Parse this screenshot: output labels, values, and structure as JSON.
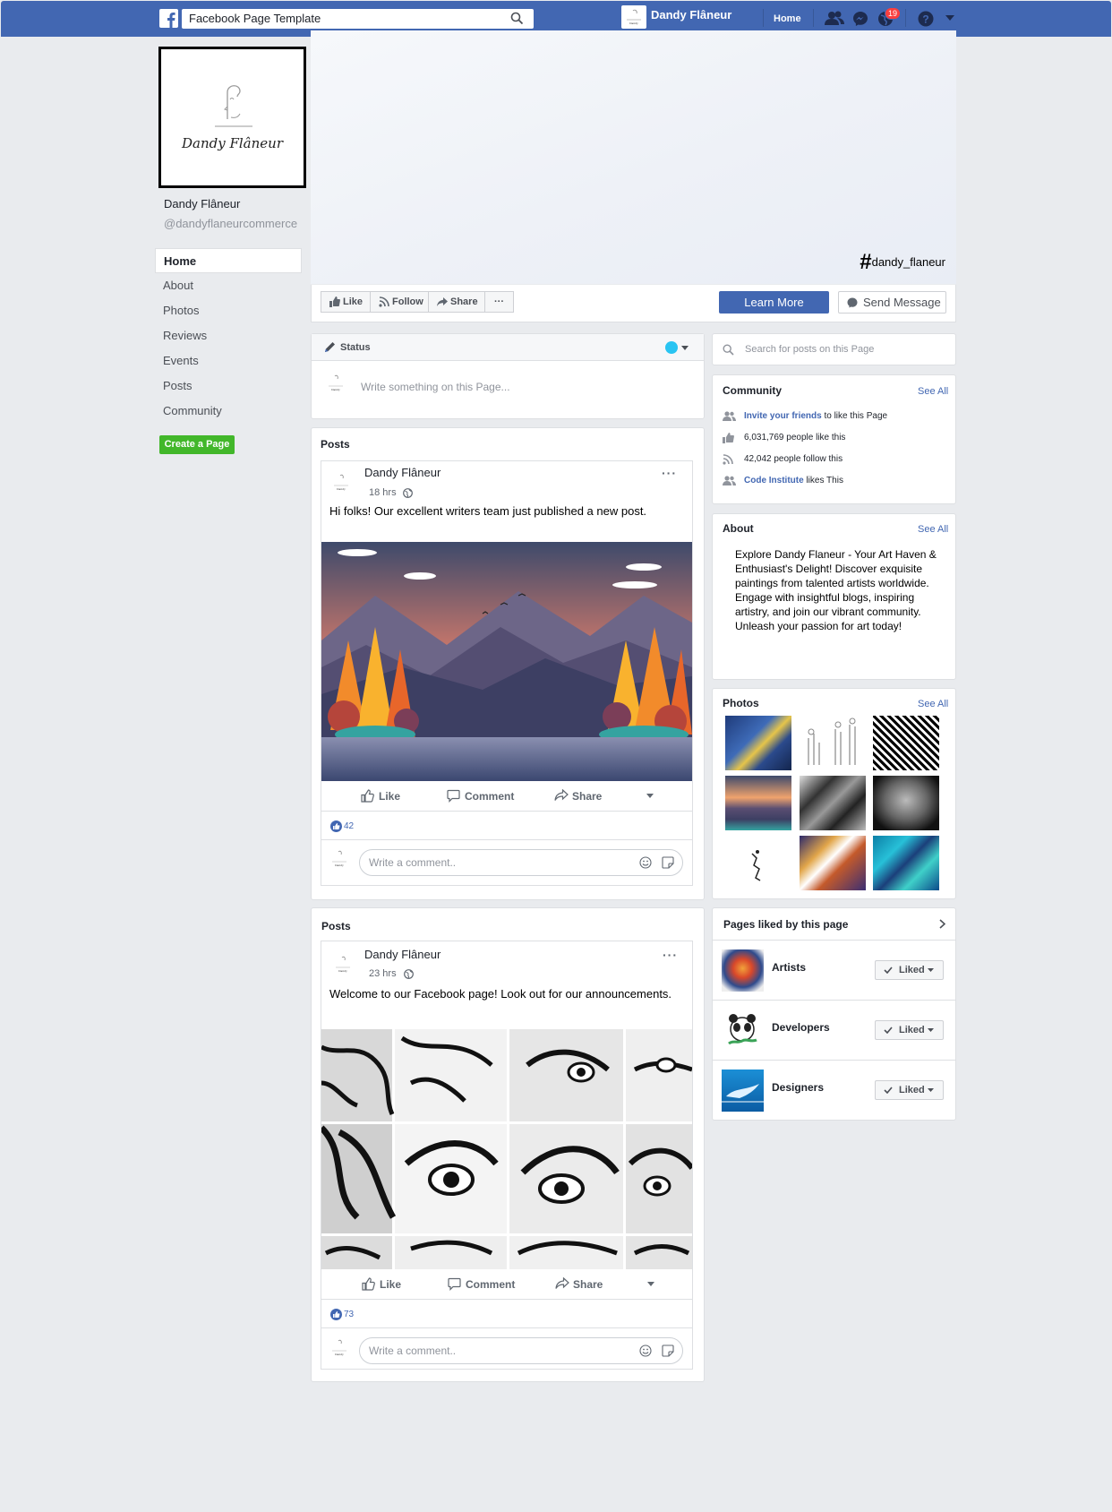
{
  "topbar": {
    "search_value": "Facebook Page Template",
    "page_name": "Dandy Flâneur",
    "home_label": "Home",
    "notification_count": "19"
  },
  "sidebar": {
    "logo_text": "Dandy Flâneur",
    "page_name": "Dandy Flâneur",
    "handle": "@dandyflaneurcommerce",
    "items": [
      {
        "label": "Home"
      },
      {
        "label": "About"
      },
      {
        "label": "Photos"
      },
      {
        "label": "Reviews"
      },
      {
        "label": "Events"
      },
      {
        "label": "Posts"
      },
      {
        "label": "Community"
      }
    ],
    "create_page_label": "Create a Page"
  },
  "cover": {
    "hashtag_symbol": "#",
    "hashtag_text": "dandy_flaneur"
  },
  "actions": {
    "like": "Like",
    "follow": "Follow",
    "share": "Share",
    "more": "···",
    "learn_more": "Learn More",
    "send_message": "Send Message"
  },
  "composer": {
    "tab_label": "Status",
    "placeholder": "Write something on this Page..."
  },
  "posts": [
    {
      "section_title": "Posts",
      "author": "Dandy Flâneur",
      "time": "18 hrs",
      "text": "Hi folks! Our excellent writers team just published a new post.",
      "like_label": "Like",
      "comment_label": "Comment",
      "share_label": "Share",
      "reaction_count": "42",
      "comment_placeholder": "Write a comment.."
    },
    {
      "section_title": "Posts",
      "author": "Dandy Flâneur",
      "time": "23 hrs",
      "text": "Welcome to our Facebook page! Look out for our announcements.",
      "like_label": "Like",
      "comment_label": "Comment",
      "share_label": "Share",
      "reaction_count": "73",
      "comment_placeholder": "Write a comment.."
    }
  ],
  "right": {
    "search_placeholder": "Search for posts on this Page",
    "community": {
      "title": "Community",
      "see_all": "See All",
      "invite_link": "Invite your friends",
      "invite_rest": " to like this Page",
      "likes": "6,031,769 people like this",
      "follows": "42,042 people follow this",
      "friend_link": "Code Institute",
      "friend_rest": " likes This"
    },
    "about": {
      "title": "About",
      "see_all": "See All",
      "text": "Explore Dandy Flaneur - Your Art Haven & Enthusiast's Delight! Discover exquisite paintings from talented artists worldwide. Engage with insightful blogs, inspiring artistry, and join our vibrant community. Unleash your passion for art today!"
    },
    "photos": {
      "title": "Photos",
      "see_all": "See All"
    },
    "pages_liked": {
      "title": "Pages liked by this page",
      "items": [
        {
          "name": "Artists",
          "button": "Liked"
        },
        {
          "name": "Developers",
          "button": "Liked"
        },
        {
          "name": "Designers",
          "button": "Liked"
        }
      ]
    }
  },
  "colors": {
    "brand_blue": "#4267b2",
    "background": "#e9ebee",
    "create_green": "#42b72a",
    "badge_red": "#fa3e3e"
  }
}
